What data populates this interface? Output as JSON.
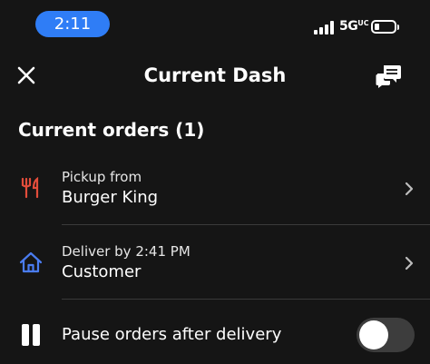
{
  "colors": {
    "accent": "#2f7df6",
    "pickup_icon": "#e34d3b",
    "deliver_icon": "#4a7cf0",
    "background": "#151515"
  },
  "status_bar": {
    "time": "2:11",
    "network": "5G",
    "network_suffix": "UC"
  },
  "header": {
    "title": "Current Dash",
    "close_icon": "close-icon",
    "chat_icon": "chat-bubbles-icon"
  },
  "orders_section": {
    "title": "Current orders (1)",
    "items": [
      {
        "icon": "fork-knife-icon",
        "line1": "Pickup from",
        "line2": "Burger King"
      },
      {
        "icon": "home-icon",
        "line1": "Deliver by 2:41 PM",
        "line2": "Customer"
      }
    ]
  },
  "pause": {
    "label": "Pause orders after delivery",
    "enabled": false
  }
}
